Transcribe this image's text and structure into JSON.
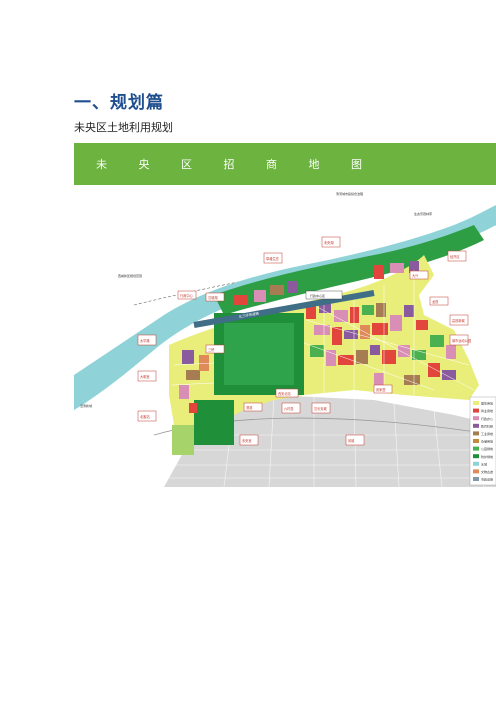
{
  "section": {
    "heading": "一、规划篇",
    "subtitle": "未央区土地利用规划"
  },
  "map": {
    "banner_title": "未 央 区 招 商 地 图",
    "banner_color": "#6cb33f",
    "colors": {
      "river": "#8fd3d8",
      "riverbank_green": "#2e9e44",
      "forest": "#1f8f3a",
      "park": "#4bb04f",
      "residential": "#e9ee7a",
      "commercial": "#e2453c",
      "industrial": "#8a5a9e",
      "public": "#d98fb5",
      "urban_gray": "#cfcfcf"
    },
    "callouts": [
      "未央湖",
      "草滩生态",
      "汉城湖",
      "行政中心",
      "经开区",
      "高铁新城",
      "城市运动公园",
      "太华路",
      "大明宫",
      "北客站",
      "西安北站",
      "六村堡",
      "汉长安城",
      "未央宫",
      "三桥",
      "渭滨",
      "凤城",
      "大兴",
      "龙首",
      "张家堡"
    ],
    "road_label": "北三环快速路",
    "center_label": "行政中心区",
    "notes": [
      "渭河城市段综合治理",
      "生态景观林带",
      "西咸新区规划范围",
      "泾渭新城"
    ],
    "legend": [
      {
        "label": "居住用地",
        "color": "#e9ee7a"
      },
      {
        "label": "商业用地",
        "color": "#e2453c"
      },
      {
        "label": "行政办公",
        "color": "#d98fb5"
      },
      {
        "label": "教育科研",
        "color": "#8a5a9e"
      },
      {
        "label": "工业用地",
        "color": "#a67c52"
      },
      {
        "label": "仓储用地",
        "color": "#c48a3c"
      },
      {
        "label": "公园绿地",
        "color": "#4bb04f"
      },
      {
        "label": "防护绿地",
        "color": "#1f8f3a"
      },
      {
        "label": "水域",
        "color": "#8fd3d8"
      },
      {
        "label": "文物古迹",
        "color": "#e08a5a"
      },
      {
        "label": "市政设施",
        "color": "#7f9aa6"
      }
    ]
  }
}
